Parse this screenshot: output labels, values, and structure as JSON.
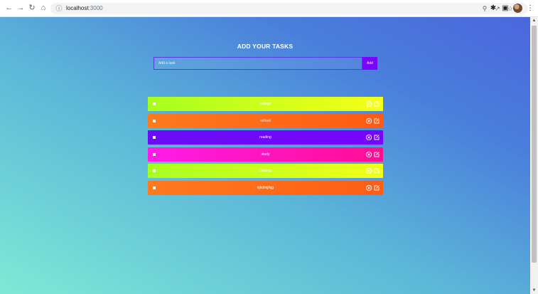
{
  "browser": {
    "url_host": "localhost",
    "url_port": ":3000",
    "icons": [
      "back-icon",
      "forward-icon",
      "reload-icon",
      "home-icon",
      "info-icon",
      "zoom-icon",
      "share-icon",
      "star-icon",
      "extensions-icon",
      "sidepanel-icon",
      "menu-icon"
    ]
  },
  "app": {
    "title": "ADD YOUR TASKS",
    "input_placeholder": "Add a task",
    "input_value": "",
    "add_label": "Add"
  },
  "tasks": [
    {
      "label": "college",
      "completed": false,
      "gradient": [
        "#a6ff1e",
        "#f6ff16"
      ]
    },
    {
      "label": "school",
      "completed": false,
      "gradient": [
        "#fd7a1d",
        "#fe5a14"
      ]
    },
    {
      "label": "reading",
      "completed": false,
      "gradient": [
        "#6a0cf5",
        "#7604ff"
      ]
    },
    {
      "label": "study",
      "completed": false,
      "gradient": [
        "#ff1be8",
        "#ff0e93"
      ]
    },
    {
      "label": "walking",
      "completed": false,
      "gradient": [
        "#a7ff22",
        "#f2ff17"
      ]
    },
    {
      "label": "kjkdhkjfkjg",
      "completed": false,
      "gradient": [
        "#ff7a1e",
        "#fe5d15"
      ]
    }
  ]
}
